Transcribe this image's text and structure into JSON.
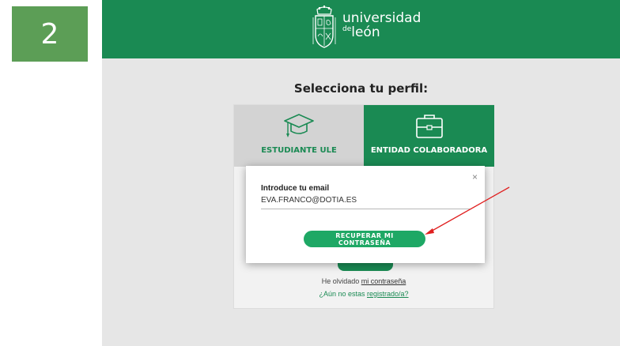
{
  "step": {
    "number": "2"
  },
  "header": {
    "brand_line1": "universidad",
    "brand_de": "de",
    "brand_leon": "león"
  },
  "page": {
    "title": "Selecciona tu perfil:"
  },
  "tabs": [
    {
      "label": "ESTUDIANTE ULE",
      "icon": "graduation-cap-icon"
    },
    {
      "label": "ENTIDAD COLABORADORA",
      "icon": "briefcase-icon",
      "active": true
    }
  ],
  "links": {
    "forgot_prefix": "He olvidado ",
    "forgot_link": "mi contraseña",
    "register_prefix": "¿Aún no estas ",
    "register_link": "registrado/a?"
  },
  "modal": {
    "close_glyph": "×",
    "label": "Introduce tu email",
    "email_value": "EVA.FRANCO@DOTIA.ES",
    "button_label": "RECUPERAR MI CONTRASEÑA"
  },
  "colors": {
    "brand_green": "#1a8a53",
    "button_green": "#1ea865",
    "badge_green": "#5c9e56",
    "arrow_red": "#e02020"
  }
}
